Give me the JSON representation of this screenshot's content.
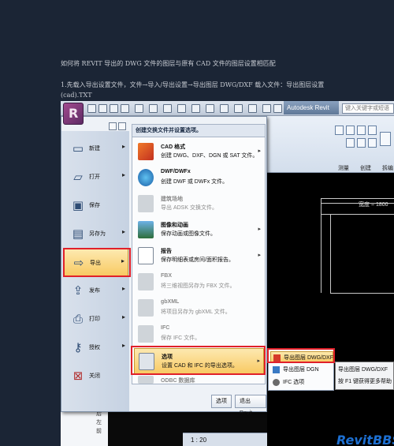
{
  "article": {
    "title": "如何将 REVIT 导出的 DWG 文件的图层与原有 CAD 文件的图层设置相匹配",
    "step1_line1": "1.先载入导出设置文件，文件→导入/导出设置→导出图层 DWG/DXF 载入文件：导出图层设置",
    "step1_line2": "(cad).TXT"
  },
  "app": {
    "title": "Autodesk Revit",
    "search_placeholder": "键入关键字或短语",
    "scale_readout": "1 : 20"
  },
  "ribbon": {
    "panels": [
      "测量",
      "创建",
      "拆编"
    ]
  },
  "canvas": {
    "dimension_label": "宽度 = 1800"
  },
  "application_menu": {
    "left_items": [
      {
        "label": "新建",
        "icon": "new-document-icon",
        "has_submenu": true
      },
      {
        "label": "打开",
        "icon": "open-folder-icon",
        "has_submenu": true
      },
      {
        "label": "保存",
        "icon": "save-icon",
        "has_submenu": false
      },
      {
        "label": "另存为",
        "icon": "save-as-icon",
        "has_submenu": true
      },
      {
        "label": "导出",
        "icon": "export-icon",
        "has_submenu": true,
        "selected": true
      },
      {
        "label": "发布",
        "icon": "publish-icon",
        "has_submenu": true
      },
      {
        "label": "打印",
        "icon": "print-icon",
        "has_submenu": true
      },
      {
        "label": "授权",
        "icon": "license-key-icon",
        "has_submenu": true
      },
      {
        "label": "关闭",
        "icon": "close-document-icon",
        "has_submenu": false
      }
    ],
    "right_header": "创建交换文件并设置选项。",
    "right_items": [
      {
        "title": "CAD 格式",
        "desc": "创建 DWG、DXF、DGN 或 SAT 文件。",
        "icon": "cad-format-icon",
        "has_submenu": true,
        "enabled": true
      },
      {
        "title": "DWF/DWFx",
        "desc": "创建 DWF 或 DWFx 文件。",
        "icon": "dwf-globe-icon",
        "has_submenu": false,
        "enabled": true
      },
      {
        "title": "建筑场地",
        "desc": "导出 ADSK 交换文件。",
        "icon": "building-site-icon",
        "has_submenu": false,
        "enabled": false
      },
      {
        "title": "图像和动画",
        "desc": "保存动画或图像文件。",
        "icon": "image-animation-icon",
        "has_submenu": true,
        "enabled": true
      },
      {
        "title": "报告",
        "desc": "保存明细表或房间/面积报告。",
        "icon": "report-icon",
        "has_submenu": true,
        "enabled": true
      },
      {
        "title": "FBX",
        "desc": "将三维视图另存为 FBX 文件。",
        "icon": "fbx-icon",
        "has_submenu": false,
        "enabled": false
      },
      {
        "title": "gbXML",
        "desc": "将项目另存为 gbXML 文件。",
        "icon": "gbxml-icon",
        "has_submenu": false,
        "enabled": false
      },
      {
        "title": "IFC",
        "desc": "保存 IFC 文件。",
        "icon": "ifc-icon",
        "has_submenu": false,
        "enabled": false
      },
      {
        "title": "选项",
        "desc": "设置 CAD 和 IFC 的导出选项。",
        "icon": "options-wrench-icon",
        "has_submenu": true,
        "enabled": true,
        "selected": true
      },
      {
        "title": "ODBC 数据库",
        "desc": "",
        "icon": "odbc-icon",
        "has_submenu": false,
        "enabled": false
      }
    ],
    "footer_buttons": [
      "选项",
      "退出 Revit"
    ]
  },
  "options_submenu": {
    "items": [
      {
        "label": "导出图层 DWG/DXF",
        "icon": "layers-dwg-icon",
        "selected": true
      },
      {
        "label": "导出图层 DGN",
        "icon": "layers-dgn-icon",
        "selected": false
      },
      {
        "label": "IFC 选项",
        "icon": "ifc-options-icon",
        "selected": false
      }
    ]
  },
  "tooltip": {
    "line1": "导出图层 DWG/DXF",
    "line2": "按 F1 键获得更多帮助"
  },
  "project_tree": {
    "items": [
      "层",
      "后",
      "左",
      "前"
    ]
  },
  "watermark": "RevitBBS",
  "colors": {
    "page_bg": "#1b2535",
    "highlight_red": "#e0202a",
    "selection_orange": "#f8ca63",
    "revit_purple": "#8b3d7c"
  }
}
